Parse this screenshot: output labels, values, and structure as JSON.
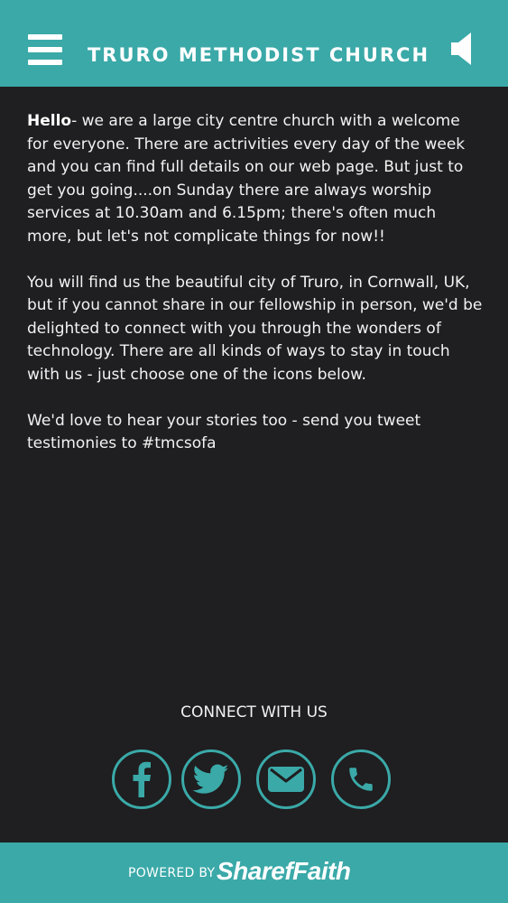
{
  "header": {
    "title": "TRURO METHODIST CHURCH",
    "menu_icon": "hamburger-icon",
    "sound_icon": "speaker-icon"
  },
  "intro": {
    "greeting": "Hello",
    "paragraph1": "- we are a large city centre church with a welcome for everyone. There are actrivities every day of the week and you can find full details on our web page. But just to get you going....on Sunday there are always worship services at 10.30am and 6.15pm; there's often much more, but let's not complicate things for now!!",
    "paragraph2": "You will find us the beautiful city of Truro, in Cornwall, UK, but if you cannot share in our fellowship in person, we'd be delighted to connect with you through the wonders of technology. There are all kinds of ways to stay in touch with us - just choose one of the icons below.",
    "paragraph3": "We'd love to hear your stories too - send you tweet testimonies to #tmcsofa"
  },
  "connect": {
    "heading": "CONNECT WITH US",
    "icons": [
      "facebook-icon",
      "twitter-icon",
      "email-icon",
      "phone-icon"
    ]
  },
  "footer": {
    "powered_by": "POWERED BY",
    "brand": "SharefFaith"
  },
  "colors": {
    "accent": "#3aa9a8",
    "background": "#1f1e20",
    "text": "#f2f2f2"
  }
}
